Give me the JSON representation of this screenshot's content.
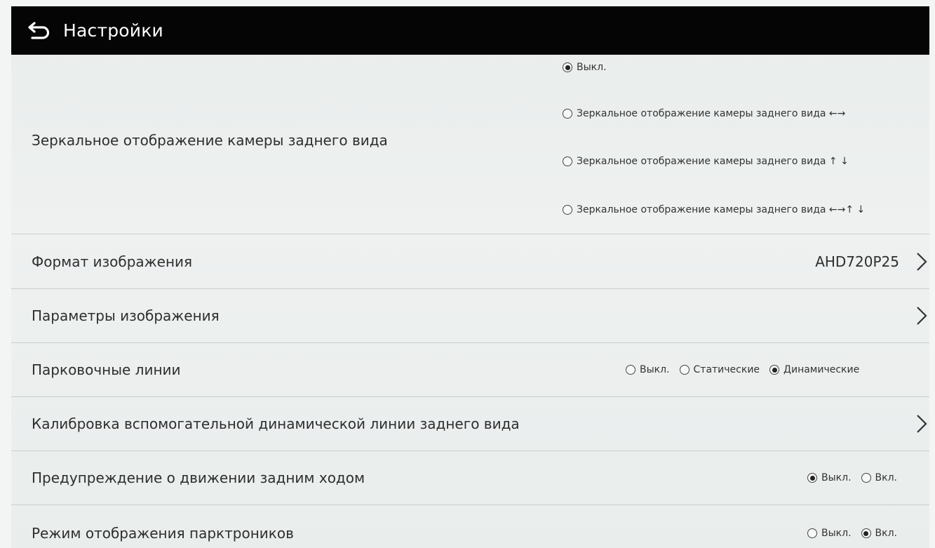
{
  "header": {
    "title": "Настройки",
    "back_icon": "back-arrow-icon"
  },
  "rows": {
    "mirror": {
      "label": "Зеркальное отображение камеры заднего вида",
      "options": [
        {
          "label": "Выкл.",
          "checked": true
        },
        {
          "label": "Зеркальное отображение камеры заднего вида ←→",
          "checked": false
        },
        {
          "label": "Зеркальное отображение камеры заднего вида ↑ ↓",
          "checked": false
        },
        {
          "label": "Зеркальное отображение камеры заднего вида ←→↑ ↓",
          "checked": false
        }
      ]
    },
    "image_format": {
      "label": "Формат изображения",
      "value": "AHD720P25"
    },
    "image_params": {
      "label": "Параметры изображения"
    },
    "parking_lines": {
      "label": "Парковочные линии",
      "options": [
        {
          "label": "Выкл.",
          "checked": false
        },
        {
          "label": "Статические",
          "checked": false
        },
        {
          "label": "Динамические",
          "checked": true
        }
      ]
    },
    "calibration": {
      "label": "Калибровка вспомогательной динамической линии заднего вида"
    },
    "reverse_warning": {
      "label": "Предупреждение о движении задним ходом",
      "options": [
        {
          "label": "Выкл.",
          "checked": true
        },
        {
          "label": "Вкл.",
          "checked": false
        }
      ]
    },
    "parktronic_mode": {
      "label": "Режим отображения парктроников",
      "options": [
        {
          "label": "Выкл.",
          "checked": false
        },
        {
          "label": "Вкл.",
          "checked": true
        }
      ]
    }
  }
}
